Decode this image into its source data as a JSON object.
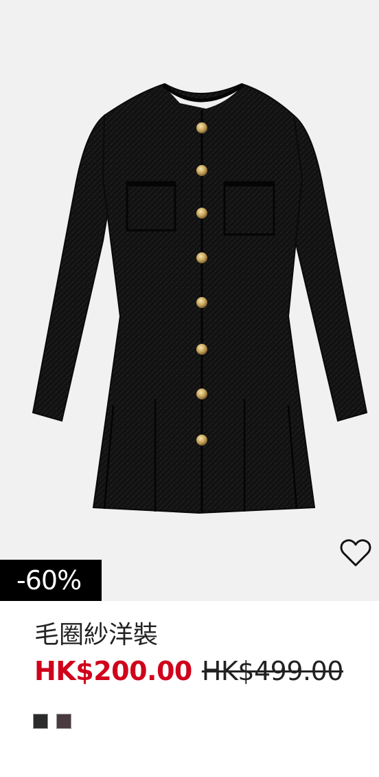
{
  "product": {
    "title": "毛圈紗洋裝",
    "sale_price": "HK$200.00",
    "original_price": "HK$499.00",
    "discount_badge": "-60%",
    "image_alt": "黑色毛圈紗長袖洋裝，金色鈕扣，百褶下擺",
    "background_color": "#f2f1f1",
    "sale_color": "#d0021b"
  },
  "wishlist": {
    "icon": "heart-outline-icon"
  },
  "swatches": [
    {
      "name": "black",
      "color": "#2b2b2b"
    },
    {
      "name": "dark-mauve",
      "color": "#4a3b3f"
    }
  ]
}
